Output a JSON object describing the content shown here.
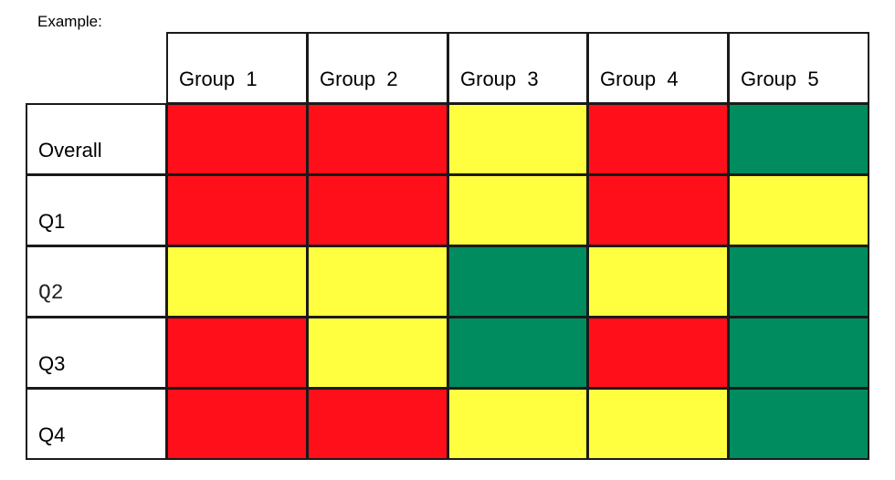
{
  "chart_data": {
    "type": "heatmap",
    "title": "",
    "caption": "Example:",
    "columns": [
      "Group  1",
      "Group  2",
      "Group  3",
      "Group  4",
      "Group  5"
    ],
    "rows": [
      "Overall",
      "Q1",
      "Q2",
      "Q3",
      "Q4"
    ],
    "status_colors": {
      "red": "#ff0f1a",
      "yellow": "#ffff40",
      "green": "#008c5e"
    },
    "values": [
      [
        "red",
        "red",
        "yellow",
        "red",
        "green"
      ],
      [
        "red",
        "red",
        "yellow",
        "red",
        "yellow"
      ],
      [
        "yellow",
        "yellow",
        "green",
        "yellow",
        "green"
      ],
      [
        "red",
        "yellow",
        "green",
        "red",
        "green"
      ],
      [
        "red",
        "red",
        "yellow",
        "yellow",
        "green"
      ]
    ],
    "monospace_row_labels": [
      "Q2"
    ]
  }
}
